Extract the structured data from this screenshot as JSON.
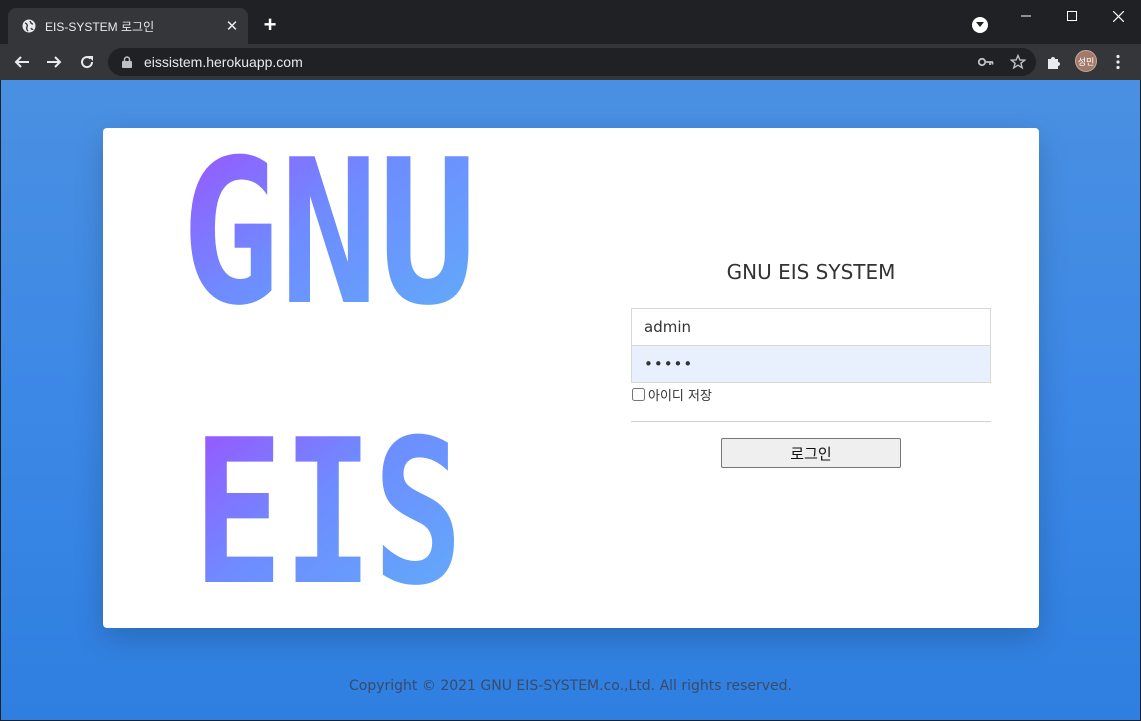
{
  "browser": {
    "tab_title": "EIS-SYSTEM 로그인",
    "url": "eissistem.herokuapp.com",
    "profile_initials": "성민"
  },
  "logo": {
    "line1": "GNU",
    "line2": "EIS",
    "gradient_start": "#a04cff",
    "gradient_mid": "#6e8cff",
    "gradient_end": "#5fb0f8"
  },
  "login": {
    "title": "GNU EIS SYSTEM",
    "username_value": "admin",
    "password_value": "•••••",
    "remember_label": "아이디 저장",
    "submit_label": "로그인"
  },
  "footer": {
    "copyright": "Copyright © 2021 GNU EIS-SYSTEM.co.,Ltd. All rights reserved."
  },
  "colors": {
    "page_bg": "#3c88e6",
    "card_bg": "#ffffff",
    "password_autofill_bg": "#e8f0fe"
  }
}
